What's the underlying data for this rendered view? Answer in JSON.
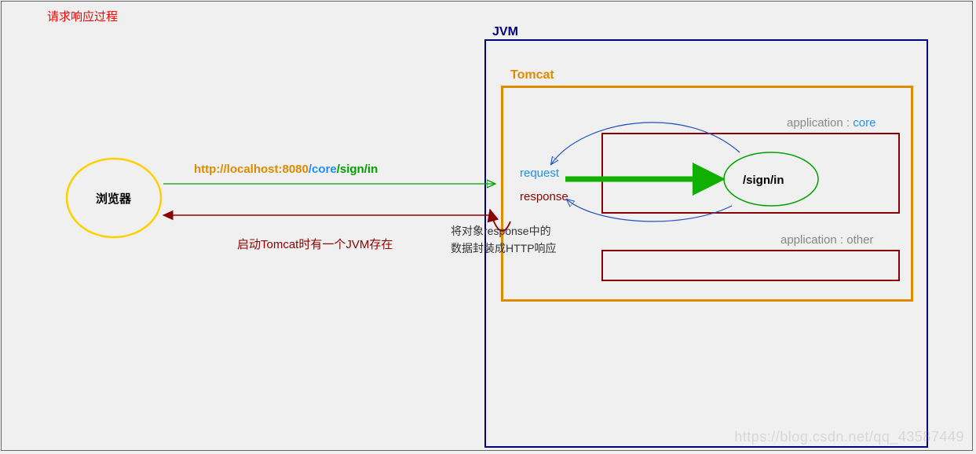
{
  "title": "请求响应过程",
  "browser_label": "浏览器",
  "url": {
    "prefix": "http://localhost:8080",
    "seg1": "/core",
    "seg2": "/sign",
    "seg3": "/in"
  },
  "jvm_label": "JVM",
  "tomcat_label": "Tomcat",
  "request_label": "request",
  "response_label": "response",
  "app_core_prefix": "application : ",
  "app_core_name": "core",
  "app_other_prefix": "application : ",
  "app_other_name": "other",
  "sign_in_label": "/sign/in",
  "tomcat_note": "启动Tomcat时有一个JVM存在",
  "response_note_line1": "将对象response中的",
  "response_note_line2": "数据封装成HTTP响应",
  "watermark": "https://blog.csdn.net/qq_43587449",
  "colors": {
    "title_red": "#ff0000",
    "darkred": "#8b0000",
    "orange": "#e08a00",
    "green": "#0fb000",
    "dark_green": "#00a000",
    "blue": "#2050c0",
    "navy": "#000080",
    "gray": "#888888",
    "yellow": "#ffd700"
  }
}
